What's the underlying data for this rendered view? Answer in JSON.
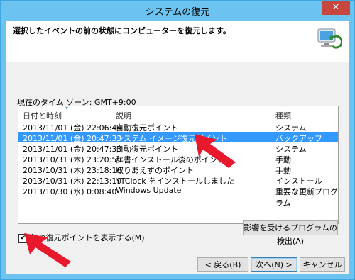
{
  "window": {
    "title": "システムの復元",
    "close_label": "✕"
  },
  "header": {
    "heading": "選択したイベントの前の状態にコンピューターを復元します。"
  },
  "timezone_text": "現在のタイム ゾーン: GMT+9:00",
  "table": {
    "columns": [
      "日付と時刻",
      "説明",
      "種類"
    ],
    "rows": [
      {
        "datetime": "2013/11/01 (金) 22:06:44",
        "desc": "自動復元ポイント",
        "type": "システム"
      },
      {
        "datetime": "2013/11/01 (金) 20:47:33",
        "desc": "システム イメージ復元ポイント",
        "type": "バックアップ"
      },
      {
        "datetime": "2013/11/01 (金) 20:47:33",
        "desc": "自動復元ポイント",
        "type": "システム"
      },
      {
        "datetime": "2013/10/31 (木) 23:20:55",
        "desc": "辞書インストール後のポイント",
        "type": "手動"
      },
      {
        "datetime": "2013/10/31 (木) 23:18:16",
        "desc": "取りあえずのポイント",
        "type": "手動"
      },
      {
        "datetime": "2013/10/31 (木) 22:13:19",
        "desc": "YTClock をインストールしました",
        "type": "インストール"
      },
      {
        "datetime": "2013/10/30 (水) 0:08:40",
        "desc": "Windows Update",
        "type": "重要な更新プログラム"
      }
    ],
    "selected_index": 1
  },
  "checkbox": {
    "label": "他の復元ポイントを表示する(M)",
    "checked": true,
    "check_glyph": "✔"
  },
  "buttons": {
    "scan": "影響を受けるプログラムの検出(A)",
    "back": "< 戻る(B)",
    "next": "次へ(N) >",
    "cancel": "キャンセル"
  },
  "colors": {
    "titlebar": "#6cc3f0",
    "selection": "#3399ff",
    "close": "#c7463d",
    "annotation_arrow": "#e8192c"
  }
}
